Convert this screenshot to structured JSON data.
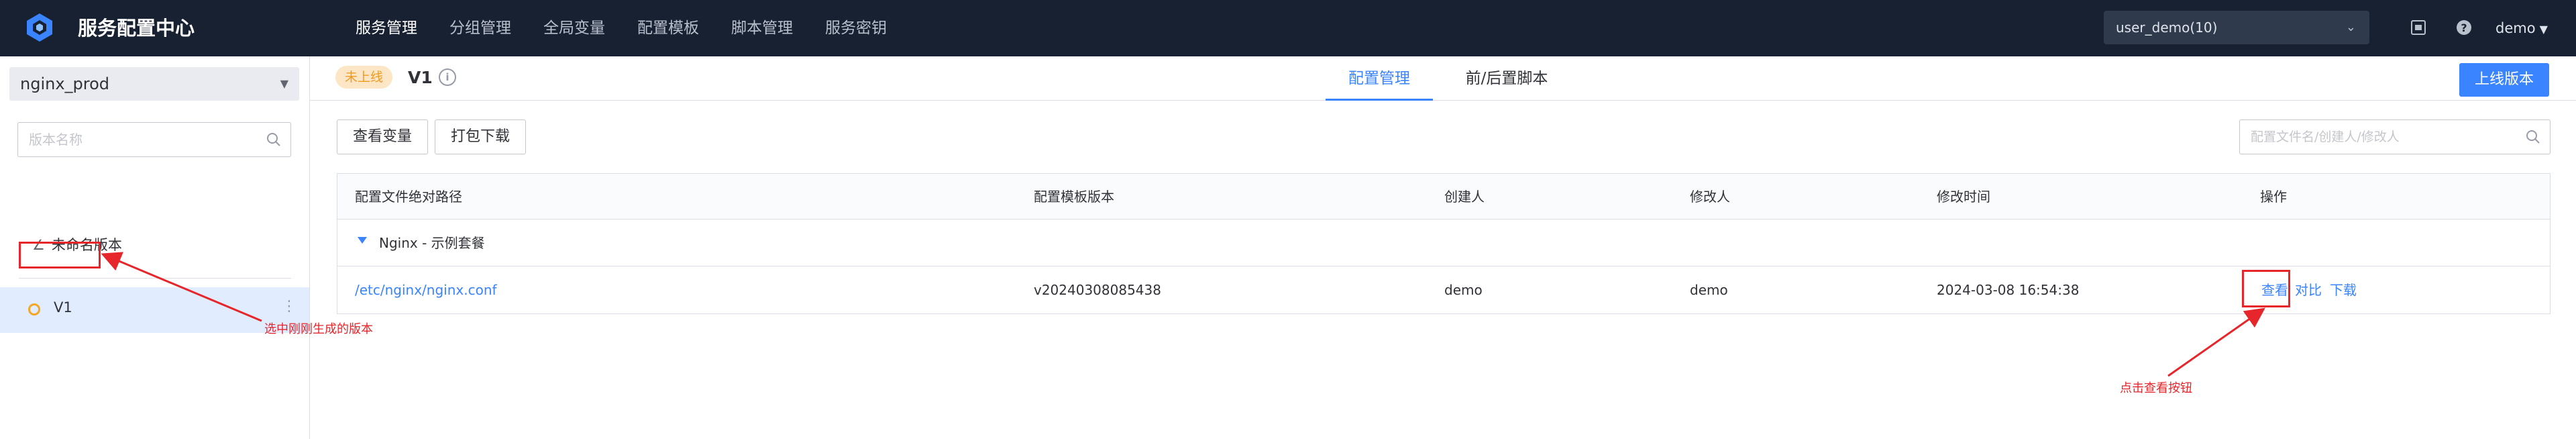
{
  "app": {
    "brand": "服务配置中心",
    "nav": [
      "服务管理",
      "分组管理",
      "全局变量",
      "配置模板",
      "脚本管理",
      "服务密钥"
    ],
    "business": "user_demo(10)",
    "user": "demo",
    "accent": "#3a84ff"
  },
  "sidebar": {
    "service": "nginx_prod",
    "search_placeholder": "版本名称",
    "unnamed_version": "未命名版本",
    "selected_version": "V1",
    "more_glyph": "⋮",
    "annotation": "选中刚刚生成的版本"
  },
  "header": {
    "status_tag": "未上线",
    "version_title": "V1",
    "info_glyph": "i",
    "tabs": [
      "配置管理",
      "前/后置脚本"
    ],
    "publish_button": "上线版本"
  },
  "toolbar": {
    "view_vars": "查看变量",
    "pack_download": "打包下载",
    "search_placeholder": "配置文件名/创建人/修改人"
  },
  "table": {
    "columns": [
      "配置文件绝对路径",
      "配置模板版本",
      "创建人",
      "修改人",
      "修改时间",
      "操作"
    ],
    "group": "Nginx - 示例套餐",
    "rows": [
      {
        "path": "/etc/nginx/nginx.conf",
        "template_version": "v20240308085438",
        "creator": "demo",
        "modifier": "demo",
        "modified_at": "2024-03-08 16:54:38",
        "actions": [
          "查看",
          "对比",
          "下载"
        ]
      }
    ],
    "annotation": "点击查看按钮"
  }
}
